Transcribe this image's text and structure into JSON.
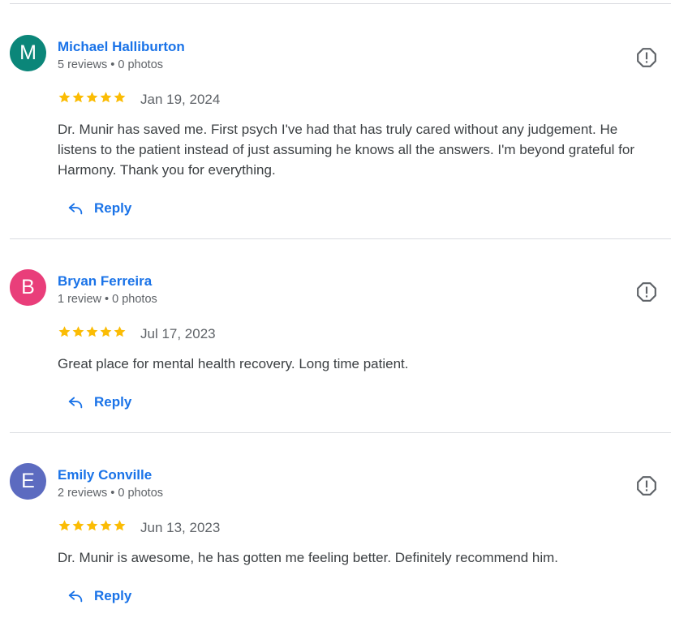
{
  "reviews": [
    {
      "initial": "M",
      "avatar_color": "#0b8679",
      "name": "Michael Halliburton",
      "meta": "5 reviews • 0 photos",
      "rating": 5,
      "date": "Jan 19, 2024",
      "text": "Dr. Munir has saved me. First psych I've had that has truly cared without any judgement. He listens to the patient instead of just assuming he knows all the answers. I'm beyond grateful for Harmony. Thank you for everything.",
      "reply_label": "Reply",
      "report_icon": "report-icon"
    },
    {
      "initial": "B",
      "avatar_color": "#e93e7a",
      "name": "Bryan Ferreira",
      "meta": "1 review • 0 photos",
      "rating": 5,
      "date": "Jul 17, 2023",
      "text": "Great place for mental health recovery. Long time patient.",
      "reply_label": "Reply",
      "report_icon": "report-icon"
    },
    {
      "initial": "E",
      "avatar_color": "#5c6bc0",
      "name": "Emily Conville",
      "meta": "2 reviews • 0 photos",
      "rating": 5,
      "date": "Jun 13, 2023",
      "text": "Dr. Munir is awesome, he has gotten me feeling better. Definitely recommend him.",
      "reply_label": "Reply",
      "report_icon": "report-icon"
    }
  ],
  "colors": {
    "link": "#1a73e8",
    "star": "#fbbc04",
    "secondary_text": "#5f6368",
    "body_text": "#3c4043",
    "divider": "#dadce0"
  }
}
